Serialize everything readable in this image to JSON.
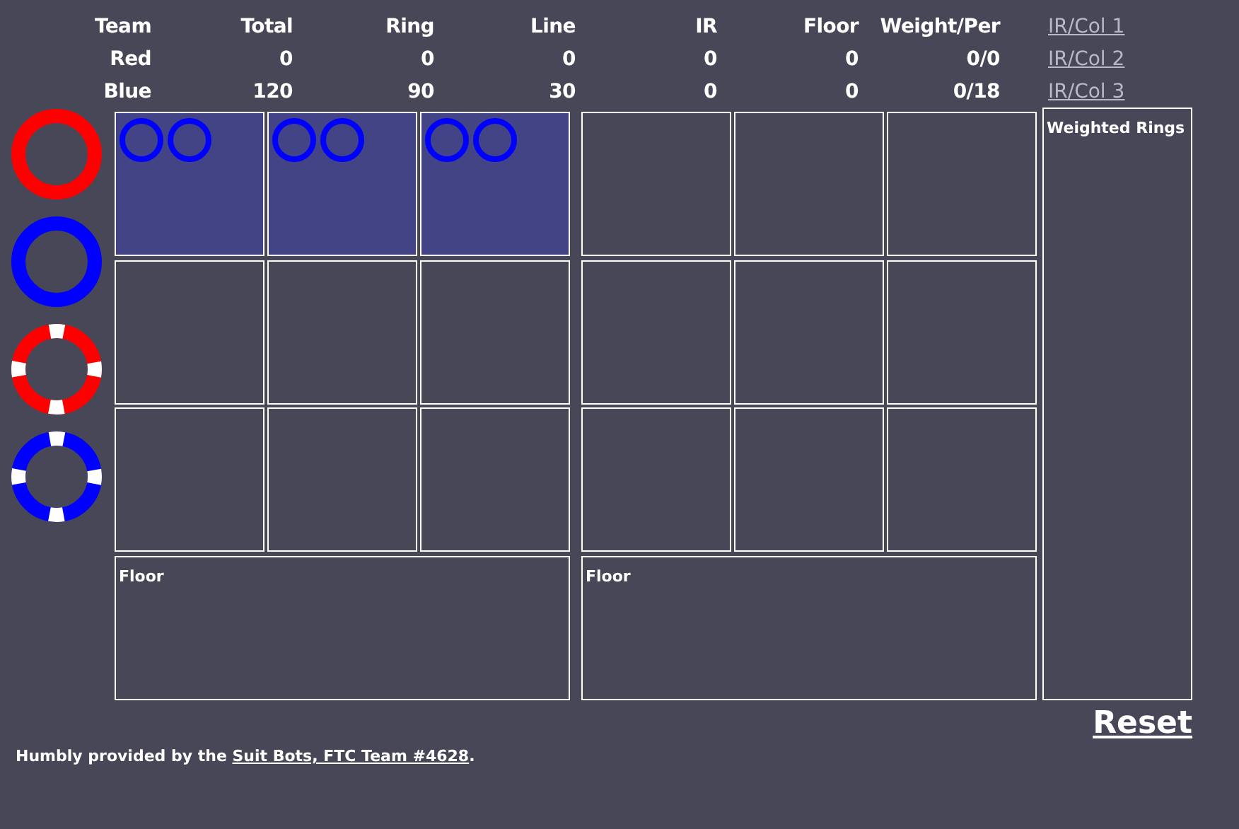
{
  "score_table": {
    "columns": [
      "Team",
      "Total",
      "Ring",
      "Line",
      "IR",
      "Floor",
      "Weight/Per"
    ],
    "rows": [
      [
        "Red",
        "0",
        "0",
        "0",
        "0",
        "0",
        "0/0"
      ],
      [
        "Blue",
        "120",
        "90",
        "30",
        "0",
        "0",
        "0/18"
      ]
    ]
  },
  "ir_links": [
    "IR/Col 1",
    "IR/Col 2",
    "IR/Col 3"
  ],
  "ring_palette": [
    {
      "kind": "plain",
      "color": "#ff0000"
    },
    {
      "kind": "plain",
      "color": "#0000ff"
    },
    {
      "kind": "weighted",
      "color": "#ff0000"
    },
    {
      "kind": "weighted",
      "color": "#0000ff"
    }
  ],
  "fields": [
    {
      "rows": [
        [
          {
            "filled": true,
            "rings": [
              {
                "color": "#0000ff"
              },
              {
                "color": "#0000ff"
              }
            ]
          },
          {
            "filled": true,
            "rings": [
              {
                "color": "#0000ff"
              },
              {
                "color": "#0000ff"
              }
            ]
          },
          {
            "filled": true,
            "rings": [
              {
                "color": "#0000ff"
              },
              {
                "color": "#0000ff"
              }
            ]
          }
        ],
        [
          {
            "filled": false
          },
          {
            "filled": false
          },
          {
            "filled": false
          }
        ],
        [
          {
            "filled": false
          },
          {
            "filled": false
          },
          {
            "filled": false
          }
        ]
      ],
      "floor": "Floor"
    },
    {
      "rows": [
        [
          {
            "filled": false
          },
          {
            "filled": false
          },
          {
            "filled": false
          }
        ],
        [
          {
            "filled": false
          },
          {
            "filled": false
          },
          {
            "filled": false
          }
        ],
        [
          {
            "filled": false
          },
          {
            "filled": false
          },
          {
            "filled": false
          }
        ]
      ],
      "floor": "Floor"
    }
  ],
  "weighted_panel": "Weighted Rings",
  "reset": "Reset",
  "footer": {
    "text": "Humbly provided by the ",
    "link": "Suit Bots, FTC Team #4628",
    "end": "."
  }
}
